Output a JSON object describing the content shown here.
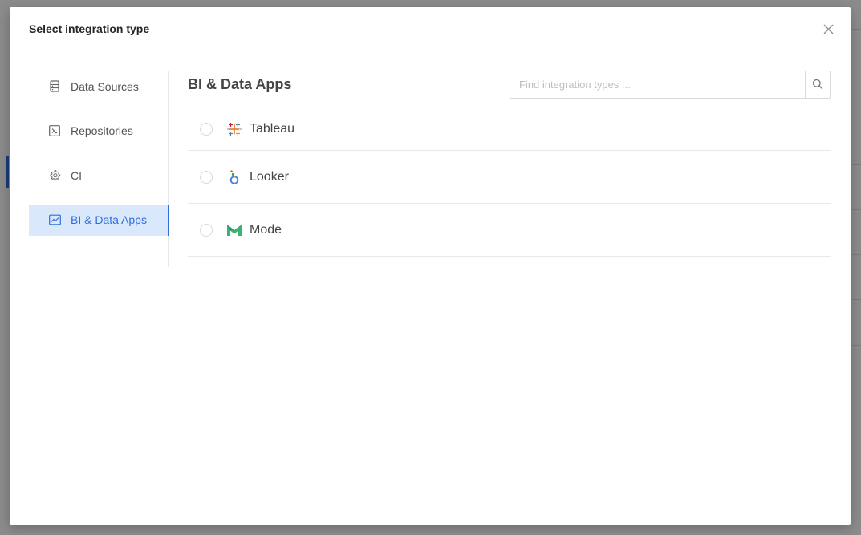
{
  "modal": {
    "title": "Select integration type"
  },
  "sidebar": {
    "items": [
      {
        "label": "Data Sources",
        "icon": "database-icon",
        "active": false
      },
      {
        "label": "Repositories",
        "icon": "terminal-icon",
        "active": false
      },
      {
        "label": "CI",
        "icon": "gear-icon",
        "active": false
      },
      {
        "label": "BI & Data Apps",
        "icon": "chart-icon",
        "active": true
      }
    ]
  },
  "main": {
    "title": "BI & Data Apps",
    "search": {
      "placeholder": "Find integration types ...",
      "value": ""
    },
    "integrations": [
      {
        "label": "Tableau",
        "icon": "tableau-logo-icon"
      },
      {
        "label": "Looker",
        "icon": "looker-logo-icon"
      },
      {
        "label": "Mode",
        "icon": "mode-logo-icon"
      }
    ]
  },
  "colors": {
    "accent": "#2f6fdc",
    "active_bg": "#d9e8fb",
    "mode_green": "#3bb273"
  }
}
